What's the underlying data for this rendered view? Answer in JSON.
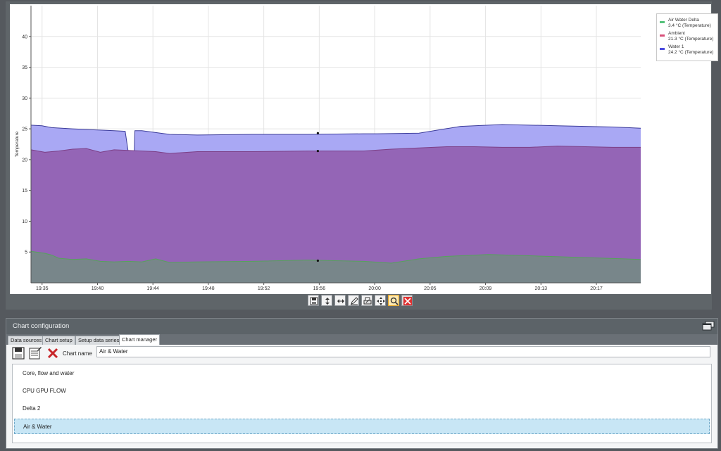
{
  "chart_data": {
    "type": "area",
    "ylabel": "Temperature",
    "ylim": [
      0,
      45
    ],
    "yticks": [
      5,
      10,
      15,
      20,
      25,
      30,
      35,
      40
    ],
    "x_tick_labels": [
      "19:35",
      "19:40",
      "19:44",
      "19:48",
      "19:52",
      "19:56",
      "20:00",
      "20:05",
      "20:09",
      "20:13",
      "20:17"
    ],
    "x_range_minutes": [
      0,
      44
    ],
    "legend_position": "top-right",
    "series": [
      {
        "name": "Water 1",
        "legend_value": "24.2 °C (Temperature)",
        "color": "#a9a8f4",
        "line_color": "#3b3b9a",
        "x": [
          0,
          0.8,
          1.5,
          3,
          5,
          6,
          6.8,
          7.1,
          7.3,
          7.5,
          8,
          10,
          12,
          16,
          20,
          24,
          25,
          28,
          31,
          34,
          38,
          42,
          44
        ],
        "values": [
          25.6,
          25.5,
          25.2,
          25.0,
          24.8,
          24.7,
          24.6,
          20.0,
          10.4,
          24.7,
          24.7,
          24.1,
          24.0,
          24.1,
          24.1,
          24.2,
          24.2,
          24.3,
          25.4,
          25.7,
          25.5,
          25.3,
          25.1
        ]
      },
      {
        "name": "Ambient",
        "legend_value": "21.3 °C (Temperature)",
        "color": "#9465b6",
        "line_color": "#7c3f86",
        "x": [
          0,
          1,
          2,
          3,
          4,
          5,
          6,
          7,
          8,
          9,
          10,
          12,
          16,
          20,
          24,
          26,
          28,
          30,
          32,
          34,
          36,
          38,
          40,
          42,
          44
        ],
        "values": [
          21.6,
          21.2,
          21.4,
          21.7,
          21.8,
          21.2,
          21.6,
          21.5,
          21.4,
          21.3,
          21.0,
          21.3,
          21.3,
          21.4,
          21.4,
          21.7,
          21.9,
          22.1,
          22.1,
          22.0,
          22.0,
          22.2,
          22.1,
          22.0,
          22.0
        ]
      },
      {
        "name": "Air Water Delta",
        "legend_value": "3.4 °C (Temperature)",
        "color": "#78868a",
        "line_color": "#55a35a",
        "x": [
          0,
          1,
          1.5,
          2,
          3,
          4,
          5,
          6,
          7,
          8,
          9,
          10,
          12,
          16,
          20,
          24,
          26,
          28,
          30,
          33,
          36,
          40,
          44
        ],
        "values": [
          5.1,
          4.8,
          4.5,
          4.0,
          3.8,
          3.9,
          3.5,
          3.4,
          3.5,
          3.4,
          3.9,
          3.3,
          3.4,
          3.5,
          3.7,
          3.5,
          3.2,
          3.9,
          4.3,
          4.6,
          4.4,
          4.1,
          3.8
        ]
      }
    ],
    "markers": [
      {
        "x": 20.7,
        "y": 24.3
      },
      {
        "x": 20.7,
        "y": 21.4
      },
      {
        "x": 20.7,
        "y": 3.6
      }
    ]
  },
  "legend": {
    "items": [
      {
        "name": "Air Water Delta",
        "value": "3.4 °C (Temperature)",
        "color": "#55c27a"
      },
      {
        "name": "Ambient",
        "value": "21.3 °C (Temperature)",
        "color": "#d9507a"
      },
      {
        "name": "Water 1",
        "value": "24.2 °C (Temperature)",
        "color": "#4a4adf"
      }
    ]
  },
  "toolbar": {
    "buttons": [
      "save-chart-icon",
      "zoom-vertical-icon",
      "zoom-horizontal-icon",
      "edit-chart-icon",
      "print-chart-icon",
      "move-chart-icon",
      "magnify-icon",
      "close-chart-icon"
    ]
  },
  "config": {
    "title": "Chart configuration",
    "tabs": [
      "Data sources",
      "Chart setup",
      "Setup data series",
      "Chart manager"
    ],
    "active_tab": "Chart manager",
    "chart_name_label": "Chart name",
    "chart_name_value": "Air & Water",
    "charts": [
      {
        "label": "Core, flow and water",
        "selected": false
      },
      {
        "label": "CPU GPU FLOW",
        "selected": false
      },
      {
        "label": "Delta 2",
        "selected": false
      },
      {
        "label": "Air & Water",
        "selected": true
      }
    ]
  }
}
